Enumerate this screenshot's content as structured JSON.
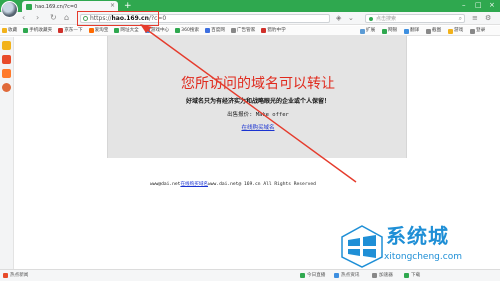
{
  "browser": {
    "tab_title": "hao.169.cn/?c=0",
    "new_tab_symbol": "+",
    "url_prefix": "https://",
    "url_domain": "hao.169.cn",
    "url_path": "/?c=0",
    "search_placeholder": "点击搜索",
    "bookmarks": [
      {
        "label": "收藏",
        "color": "#f2b21b"
      },
      {
        "label": "手机收藏夹",
        "color": "#2fa84f"
      },
      {
        "label": "京东—下",
        "color": "#d0302a"
      },
      {
        "label": "爱淘宝",
        "color": "#ff6a00"
      },
      {
        "label": "网址大全",
        "color": "#2fa84f"
      },
      {
        "label": "游戏中心",
        "color": "#3d8fe0"
      },
      {
        "label": "360搜索",
        "color": "#2fa84f"
      },
      {
        "label": "百度网",
        "color": "#3d6fe0"
      },
      {
        "label": "广告管家",
        "color": "#888888"
      },
      {
        "label": "猎豹中学",
        "color": "#d0302a"
      }
    ],
    "bookmarks_right": [
      {
        "label": "扩展",
        "color": "#5b9bd5"
      },
      {
        "label": "网银",
        "color": "#2fa84f"
      },
      {
        "label": "翻译",
        "color": "#3d8fe0"
      },
      {
        "label": "截图",
        "color": "#888888"
      },
      {
        "label": "游戏",
        "color": "#f2b21b"
      },
      {
        "label": "登录",
        "color": "#888888"
      }
    ]
  },
  "page": {
    "headline": "您所访问的域名可以转让",
    "subline": "好域名只为有经济实力和战略眼光的企业或个人保留！",
    "offer": "出售报价: Make offer",
    "buy_link": "在线购买域名",
    "footer_prefix": "www@dai.net",
    "footer_link": "在线购买域名",
    "footer_suffix": "www.dai.net@  169.cn All Rights Reserved"
  },
  "watermark": {
    "name": "系统城",
    "url": "xitongcheng.com"
  },
  "status": {
    "left_label": "热点新闻",
    "items": [
      "今日直播",
      "热点资讯",
      "加速器",
      "下载"
    ]
  },
  "colors": {
    "accent_green": "#2fa84f",
    "headline_red": "#e02a1d",
    "link_blue": "#1a33d1",
    "watermark_blue": "#1f8fd6"
  }
}
